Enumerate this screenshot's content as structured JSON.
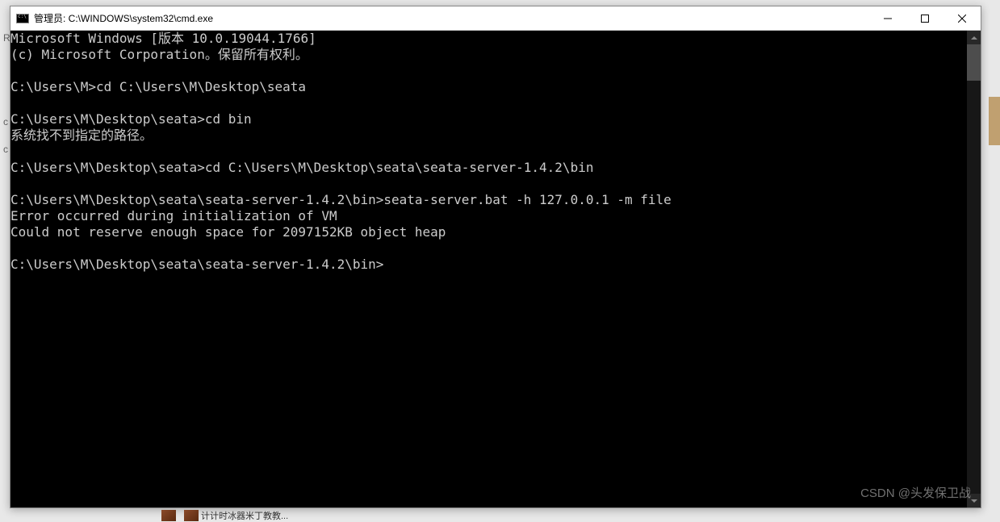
{
  "window": {
    "title": "管理员: C:\\WINDOWS\\system32\\cmd.exe"
  },
  "terminal": {
    "lines": [
      "Microsoft Windows [版本 10.0.19044.1766]",
      "(c) Microsoft Corporation。保留所有权利。",
      "",
      "C:\\Users\\M>cd C:\\Users\\M\\Desktop\\seata",
      "",
      "C:\\Users\\M\\Desktop\\seata>cd bin",
      "系统找不到指定的路径。",
      "",
      "C:\\Users\\M\\Desktop\\seata>cd C:\\Users\\M\\Desktop\\seata\\seata-server-1.4.2\\bin",
      "",
      "C:\\Users\\M\\Desktop\\seata\\seata-server-1.4.2\\bin>seata-server.bat -h 127.0.0.1 -m file",
      "Error occurred during initialization of VM",
      "Could not reserve enough space for 2097152KB object heap",
      "",
      "C:\\Users\\M\\Desktop\\seata\\seata-server-1.4.2\\bin>"
    ]
  },
  "watermark": "CSDN @头发保卫战",
  "taskbar": {
    "item1": "计计时冰器米丁教教..."
  },
  "left_edge": {
    "c1": "R",
    "c2": "c",
    "c3": "c"
  }
}
